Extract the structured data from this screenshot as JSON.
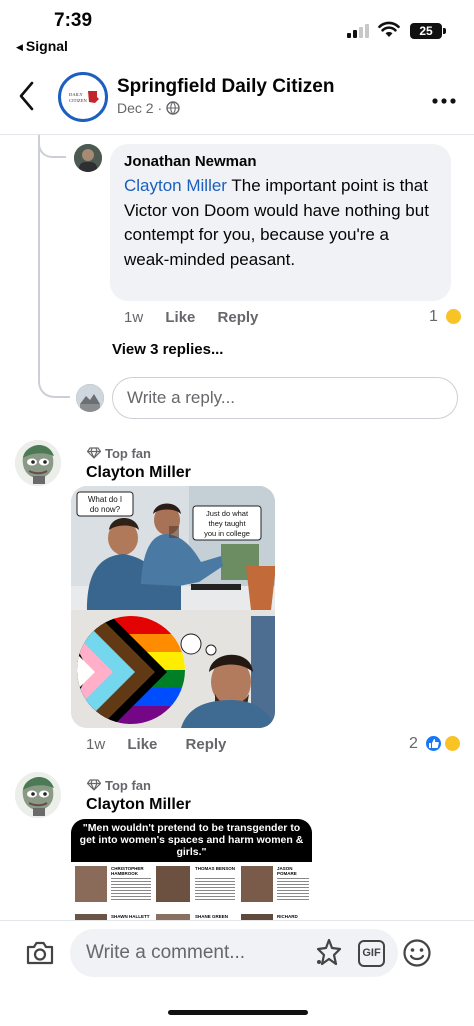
{
  "status_bar": {
    "time": "7:39",
    "back_app": "Signal",
    "battery": "25"
  },
  "header": {
    "page_name": "Springfield Daily Citizen",
    "date": "Dec 2",
    "logo_text": "DAILY CITIZEN"
  },
  "reply": {
    "author": "Jonathan Newman",
    "mention": "Clayton Miller",
    "text": " The important point is that Victor von Doom would have nothing but contempt for you, because you're a weak-minded peasant.",
    "age": "1w",
    "like": "Like",
    "reply": "Reply",
    "reactions": "1"
  },
  "view_replies": "View 3 replies...",
  "reply_input": {
    "placeholder": "Write a reply..."
  },
  "comment1": {
    "badge": "Top fan",
    "author": "Clayton Miller",
    "meme_bubble_left": "What do I do now?",
    "meme_bubble_right": "Just do what they taught you in college",
    "age": "1w",
    "like": "Like",
    "reply": "Reply",
    "reactions": "2"
  },
  "comment2": {
    "badge": "Top fan",
    "author": "Clayton Miller",
    "meme_headline": "\"Men wouldn't pretend to be transgender to get into women's spaces and harm women & girls.\"",
    "meme_names": [
      "CHRISTOPHER HAMBROOK",
      "THOMAS BENSON",
      "JASON POMARE",
      "SHAWN HALLETT",
      "SHANE GREEN",
      "RICHARD RODRIGUEZ"
    ]
  },
  "composer": {
    "placeholder": "Write a comment..."
  },
  "icons": {
    "back": "chevron-left-icon",
    "more": "more-horizontal-icon",
    "camera": "camera-icon",
    "sticker": "sticker-icon",
    "gif": "GIF",
    "emoji": "emoji-icon",
    "globe": "globe-icon",
    "top_fan": "diamond-icon"
  },
  "colors": {
    "link_blue": "#1b5fbf",
    "bubble_bg": "#f0f2f5",
    "meta_gray": "#65676b",
    "like_blue": "#1877f2",
    "haha_yellow": "#f7c325"
  }
}
